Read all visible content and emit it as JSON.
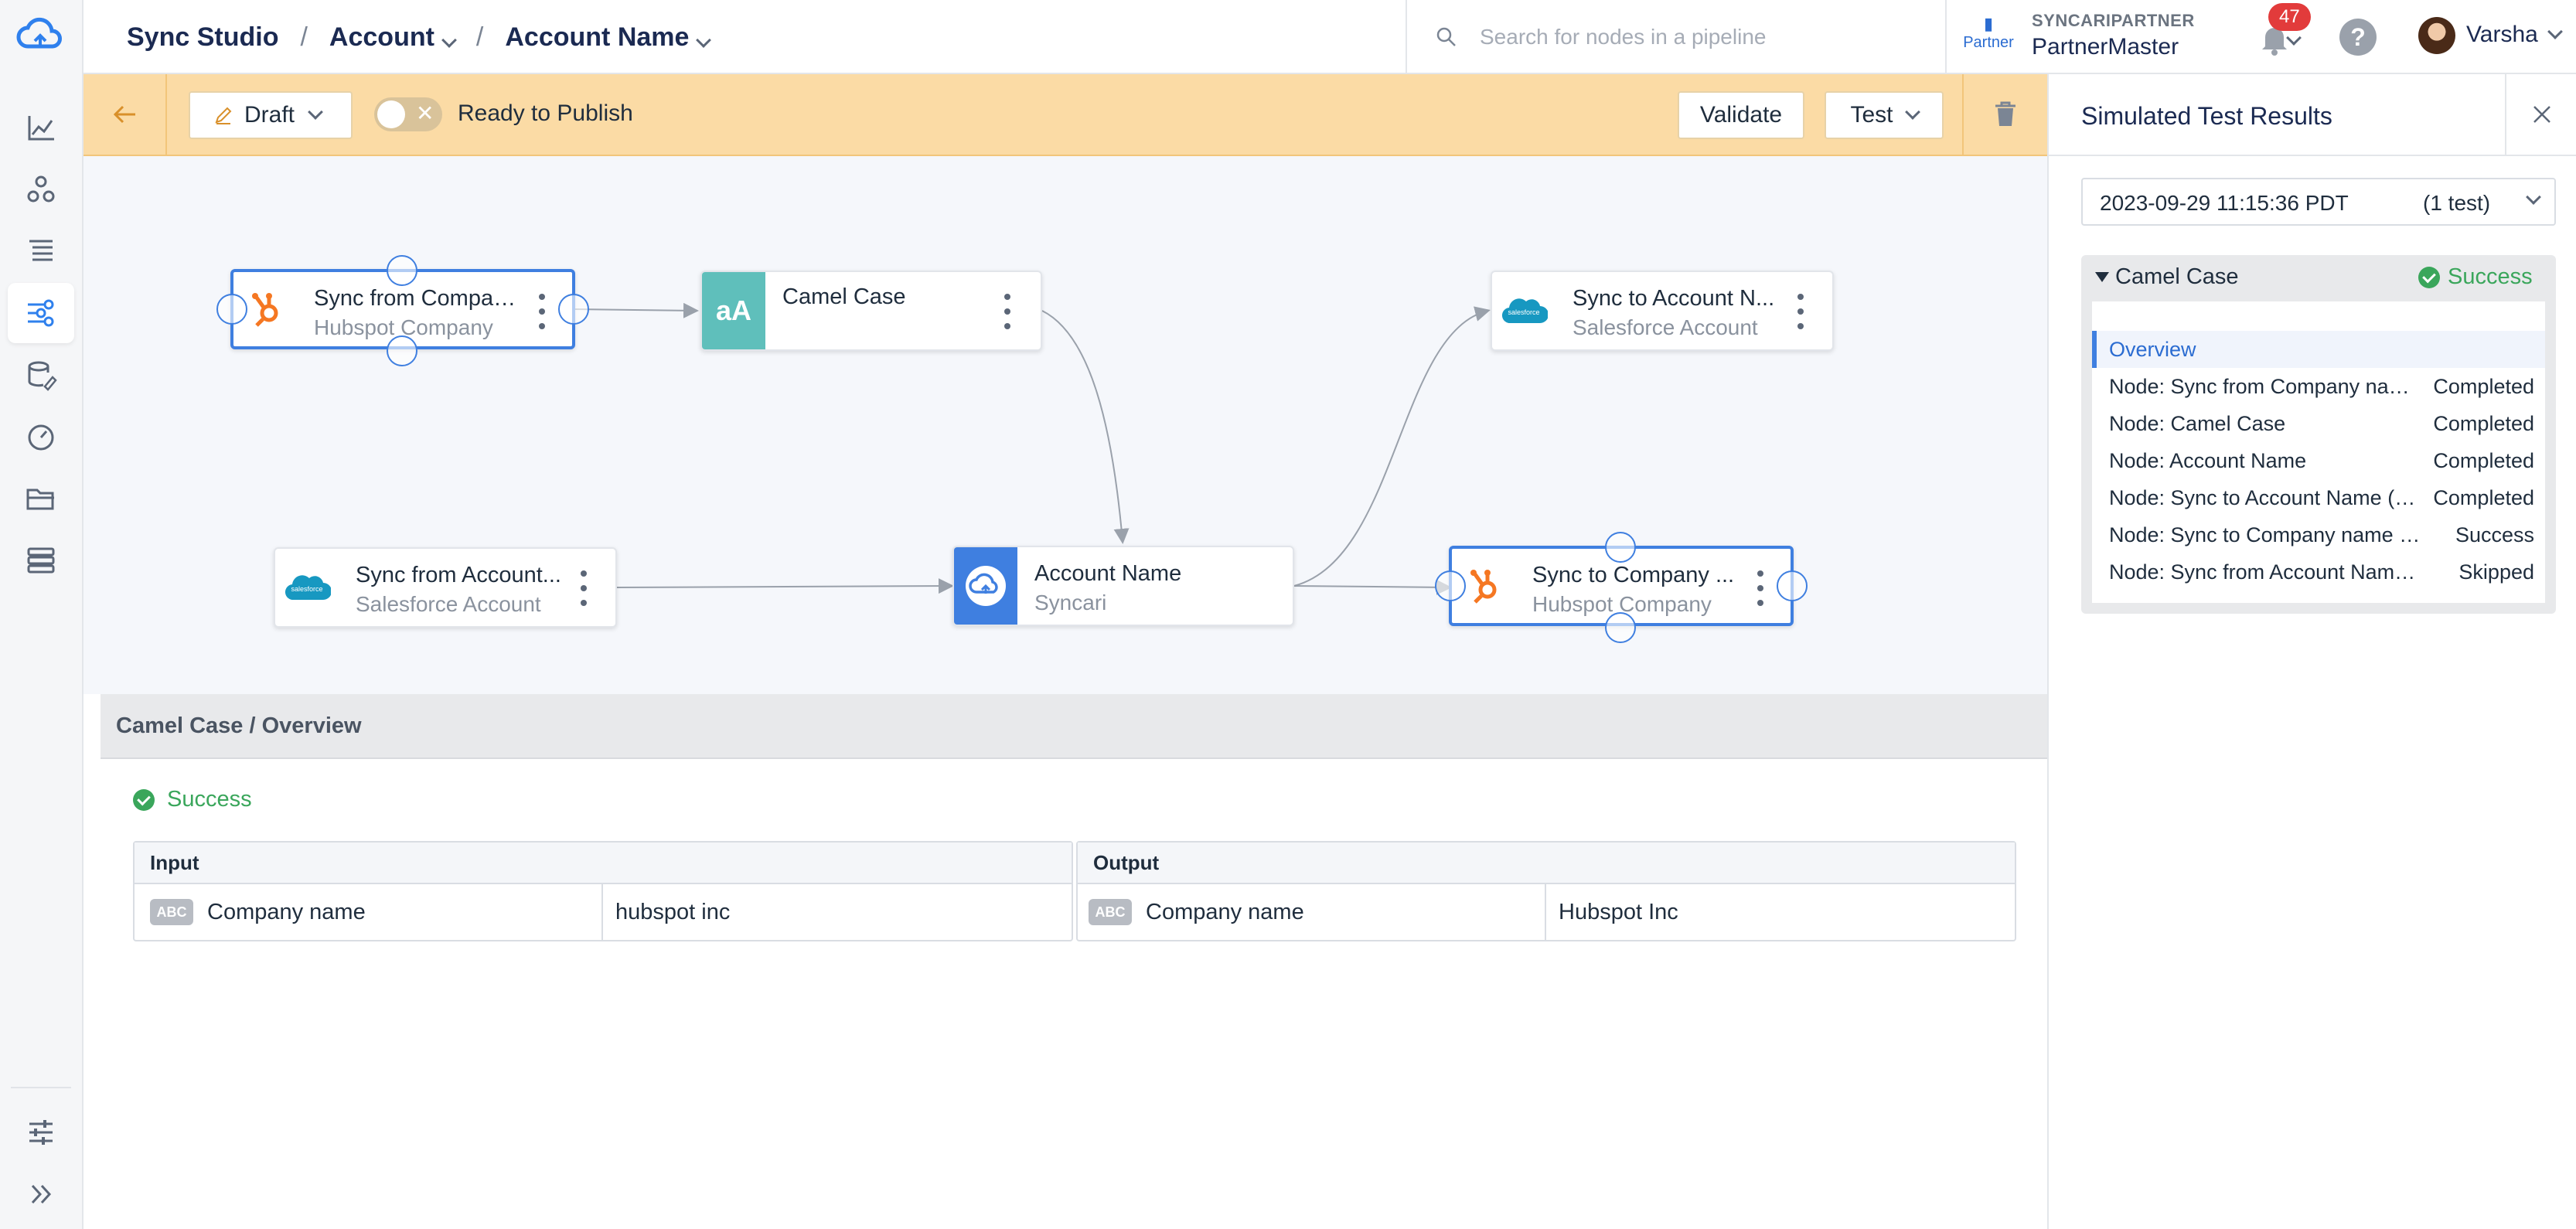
{
  "header": {
    "breadcrumbs": [
      "Sync Studio",
      "Account",
      "Account Name"
    ],
    "search_placeholder": "Search for nodes in a pipeline",
    "partner_logo_text": "Partner",
    "partner_label": "SYNCARIPARTNER",
    "partner_name": "PartnerMaster",
    "notification_count": "47",
    "help_label": "?",
    "user_name": "Varsha"
  },
  "toolbar": {
    "draft_label": "Draft",
    "publish_label": "Ready to Publish",
    "toggle_off_glyph": "✕",
    "validate_label": "Validate",
    "test_label": "Test"
  },
  "canvas": {
    "nodes": [
      {
        "title": "Sync from Compan...",
        "subtitle": "Hubspot Company",
        "icon": "hubspot-icon"
      },
      {
        "title": "Camel Case",
        "subtitle": "",
        "icon": "camel-case-icon",
        "icon_text": "aA"
      },
      {
        "title": "Sync to Account N...",
        "subtitle": "Salesforce Account",
        "icon": "salesforce-icon"
      },
      {
        "title": "Sync from Account...",
        "subtitle": "Salesforce Account",
        "icon": "salesforce-icon"
      },
      {
        "title": "Account Name",
        "subtitle": "Syncari",
        "icon": "syncari-icon"
      },
      {
        "title": "Sync to Company ...",
        "subtitle": "Hubspot Company",
        "icon": "hubspot-icon"
      }
    ],
    "salesforce_logo_text": "salesforce"
  },
  "bottom_panel": {
    "title": "Camel Case / Overview",
    "status": "Success",
    "input": {
      "header": "Input",
      "type_badge": "ABC",
      "field": "Company name",
      "value": "hubspot inc"
    },
    "output": {
      "header": "Output",
      "type_badge": "ABC",
      "field": "Company name",
      "value": "Hubspot Inc"
    }
  },
  "right_panel": {
    "title": "Simulated Test Results",
    "run_date": "2023-09-29 11:15:36 PDT",
    "run_count": "(1 test)",
    "card_title": "Camel Case",
    "card_status": "Success",
    "items": [
      {
        "label": "Overview",
        "status": ""
      },
      {
        "label": "Node: Sync from Company name (Hubspot Company)",
        "status": "Completed"
      },
      {
        "label": "Node: Camel Case",
        "status": "Completed"
      },
      {
        "label": "Node: Account Name",
        "status": "Completed"
      },
      {
        "label": "Node: Sync to Account Name (Salesforce Account)",
        "status": "Completed"
      },
      {
        "label": "Node: Sync to Company name (Hubspot Company)",
        "status": "Success"
      },
      {
        "label": "Node: Sync from Account Name (Salesforce Account)",
        "status": "Skipped"
      }
    ]
  },
  "colors": {
    "accent": "#3f7fe0",
    "toolbar_bg": "#fbdba5",
    "success": "#3aa65b",
    "hubspot": "#f57722",
    "salesforce": "#1798c1",
    "camel_case": "#5fbfbb"
  }
}
